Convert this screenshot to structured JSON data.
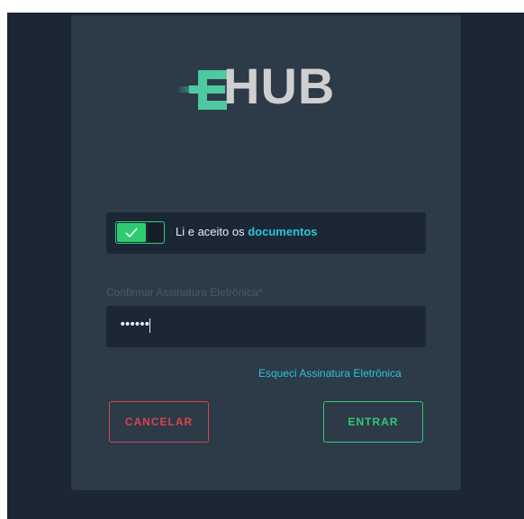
{
  "colors": {
    "page_background": "#1c2735",
    "card_background": "#2d3a48",
    "accent_green": "#2ecc71",
    "accent_cyan": "#2ec4d6",
    "danger_red": "#d9434f",
    "logo_gray": "#cfcfcf",
    "logo_green": "#4fc9a0"
  },
  "logo": {
    "text": "HUB",
    "mark": "E"
  },
  "terms": {
    "toggle_state": "on",
    "toggle_icon": "check-icon",
    "label": "Li e aceito os",
    "link": "documentos"
  },
  "signature": {
    "label": "Confirmar Assinatura Eletrônica*",
    "value": "••••••",
    "forgot_link": "Esqueci Assinatura Eletrônica"
  },
  "buttons": {
    "cancel": "CANCELAR",
    "enter": "ENTRAR"
  }
}
